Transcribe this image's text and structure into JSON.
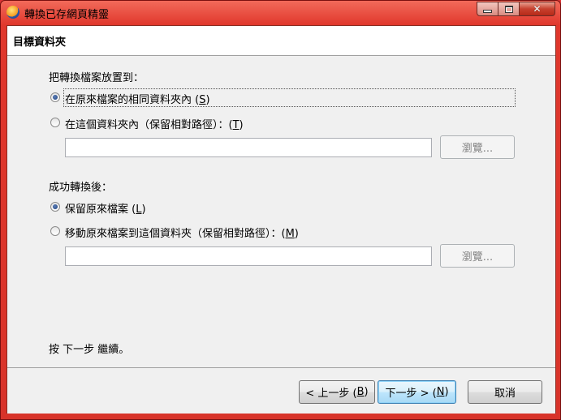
{
  "window": {
    "title": "轉換已存網頁精靈"
  },
  "header": {
    "title": "目標資料夾"
  },
  "destination": {
    "group_label": "把轉換檔案放置到：",
    "options": [
      {
        "label": "在原來檔案的相同資料夾內 (",
        "mnemonic": "S",
        "suffix": ")",
        "selected": true
      },
      {
        "label": "在這個資料夾內（保留相對路徑）：(",
        "mnemonic": "T",
        "suffix": ")",
        "selected": false
      }
    ],
    "path_value": "",
    "browse_label": "瀏覽..."
  },
  "after": {
    "group_label": "成功轉換後：",
    "options": [
      {
        "label": "保留原來檔案 (",
        "mnemonic": "L",
        "suffix": ")",
        "selected": true
      },
      {
        "label": "移動原來檔案到這個資料夾（保留相對路徑）：(",
        "mnemonic": "M",
        "suffix": ")",
        "selected": false
      }
    ],
    "path_value": "",
    "browse_label": "瀏覽..."
  },
  "instruction": "按 下一步 繼續。",
  "footer": {
    "back": {
      "label": "< 上一步 (",
      "mnemonic": "B",
      "suffix": ")"
    },
    "next": {
      "label": "下一步 > (",
      "mnemonic": "N",
      "suffix": ")"
    },
    "cancel_label": "取消"
  },
  "colors": {
    "frame": "#d33",
    "selected_radio": "#1c3f7c"
  }
}
